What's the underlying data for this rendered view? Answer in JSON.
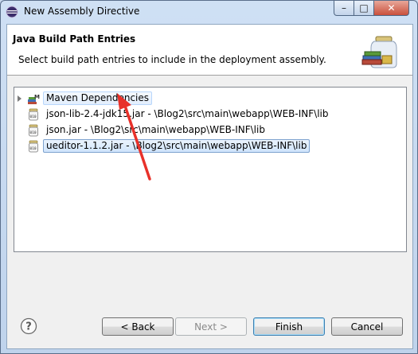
{
  "window": {
    "title": "New Assembly Directive",
    "controls": {
      "minimize": "–",
      "maximize": "□",
      "close": "✕"
    }
  },
  "header": {
    "title": "Java Build Path Entries",
    "description": "Select build path entries to include in the deployment assembly.",
    "icon": "library-jar-icon"
  },
  "tree": {
    "items": [
      {
        "label": "Maven Dependencies",
        "icon": "maven-library-icon",
        "expandable": true,
        "state": "hover"
      },
      {
        "label": "json-lib-2.4-jdk15.jar - \\Blog2\\src\\main\\webapp\\WEB-INF\\lib",
        "icon": "jar-file-icon",
        "expandable": false,
        "state": "normal"
      },
      {
        "label": "json.jar - \\Blog2\\src\\main\\webapp\\WEB-INF\\lib",
        "icon": "jar-file-icon",
        "expandable": false,
        "state": "normal"
      },
      {
        "label": "ueditor-1.1.2.jar - \\Blog2\\src\\main\\webapp\\WEB-INF\\lib",
        "icon": "jar-file-icon",
        "expandable": false,
        "state": "selected"
      }
    ]
  },
  "buttons": {
    "back": "< Back",
    "next": "Next >",
    "finish": "Finish",
    "cancel": "Cancel"
  },
  "colors": {
    "accent": "#3c7fb1",
    "annotation_arrow": "#e8312a"
  }
}
